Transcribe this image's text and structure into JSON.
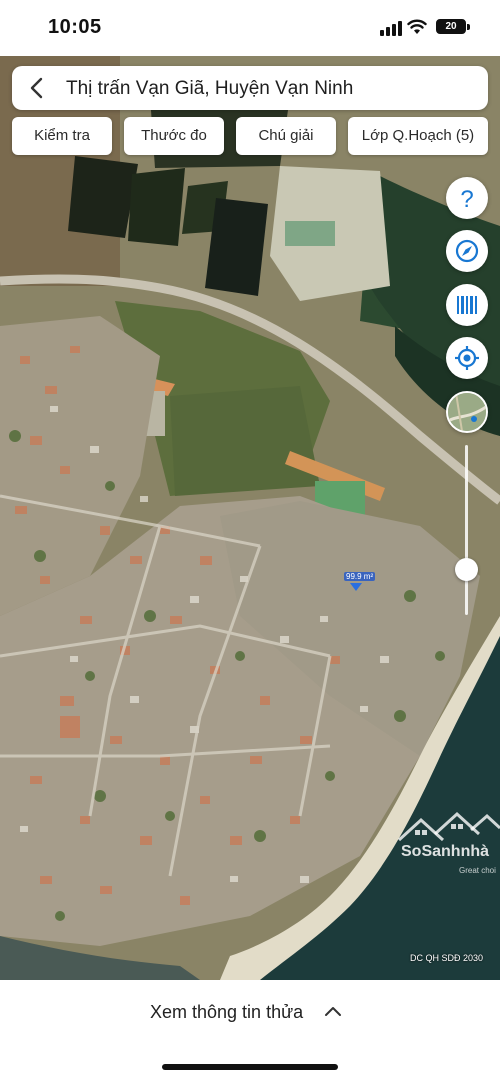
{
  "status_bar": {
    "time": "10:05",
    "battery": "20",
    "icons": [
      "signal-icon",
      "wifi-icon",
      "battery-icon"
    ]
  },
  "search": {
    "title": "Thị trấn Vạn Giã, Huyện Vạn Ninh",
    "back_icon": "chevron-left-icon"
  },
  "filters": [
    {
      "label": "Kiểm tra"
    },
    {
      "label": "Thước đo"
    },
    {
      "label": "Chú giải"
    },
    {
      "label": "Lớp Q.Hoạch (5)"
    }
  ],
  "controls": {
    "icons": [
      "help-icon",
      "compass-icon",
      "barcode-icon",
      "locate-icon",
      "layer-thumbnail",
      "opacity-slider"
    ],
    "accent_color": "#1877d2"
  },
  "map": {
    "parcel_area": "99.9 m²",
    "watermark": "SoSanhnhà",
    "watermark_sub": "Great choi",
    "attribution": "DC QH SDĐ 2030"
  },
  "bottom_sheet": {
    "label": "Xem thông tin thửa",
    "icon": "chevron-up-icon"
  }
}
